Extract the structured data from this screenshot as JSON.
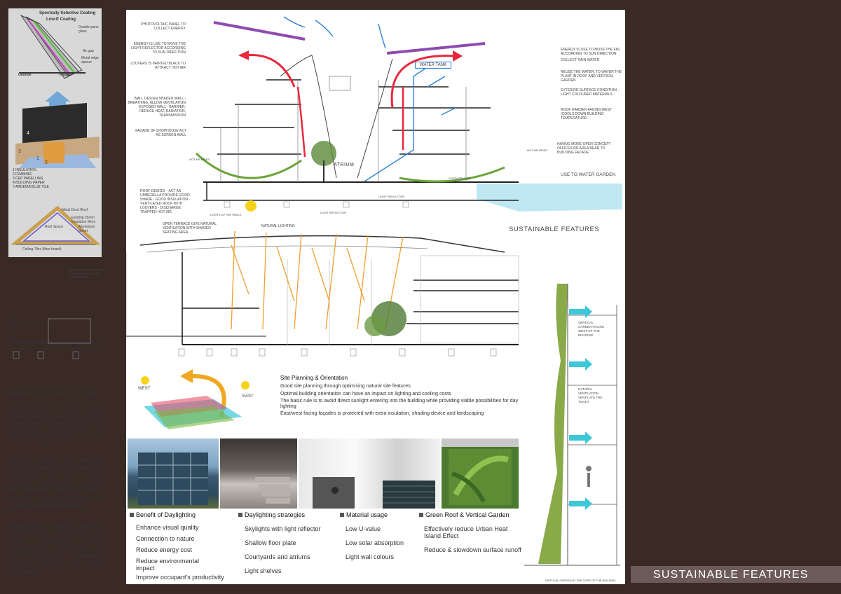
{
  "title_banner": "SUSTAINABLE FEATURES",
  "section_title": "SUSTAINABLE FEATURES",
  "coating_diagram": {
    "title1": "Spectrally Selective Coating",
    "title2": "Low-E Coating",
    "labels": [
      "Double-pane glass",
      "Air gap",
      "Metal edge spacer"
    ],
    "outside": "Outside",
    "inside": "Inside"
  },
  "roof_layers": {
    "numbers": [
      "1",
      "2",
      "3",
      "4"
    ],
    "list": [
      "1 INSULATION",
      "2 FRAMING",
      "3 CEP PANELLING",
      "4 BUILDING PAPER",
      "7 ARDESIA BLUE TILE"
    ]
  },
  "roof_section": {
    "labels": [
      "Metal Deck Roof",
      "Existing 25mm Insulation Wool",
      "Roof Space",
      "Aluminium Sheet",
      "Ceiling Tiles (fiber board)"
    ]
  },
  "section_top": {
    "left_notes": [
      "PHOTOVOLTAIC PANEL TO COLLECT ENERGY",
      "ENERGY IS USE TO MOVE THE LIGHT REFLECTOR ACCORDING TO SUN DIRECTION",
      "LOUVERS IS PAINTED BLACK TO ATTRACT HOT AIR",
      "WALL DESIGN SHADED WALL - BREATHING, ALLOW VENTILATION EXPOSED WALL - BARRIER, REDUCE HEAT, RADIATION, TRANSMISSION",
      "FACADE OF SHOPHOUSE ACT AS SCREEN WALL"
    ],
    "right_notes": [
      "ENERGY IS USE TO MOVE THE FIN ACCORDING TO SUN DIRECTION",
      "COLLECT RAIN WATER",
      "REUSE THE WATER, TO WATER THE PLANT IN ROOF AND VERTICAL GARDEN",
      "EXTERIOR SURFACE CONDITION -LIGHT COLOURED MATERIALS",
      "ROOF GARDEN FACING WEST (COOLS DOWN BUILDING TEMPERATURE",
      "HAVING MORE OPEN CONCEPT OFFICES OR AREA NEAR TO BUILDING FACADE",
      "USE TO WATER GARDEN"
    ],
    "water_tank": "WATER TANK",
    "atrium": "ATRIUM",
    "hot_air_rises_left": "HOT AIR RISES",
    "hot_air_rises_right": "HOT AIR RISES",
    "outdoor_cafe": "OUTDOOR CAFE",
    "roof_design": "ROOF DESIGN: - ACT AS UMBERELLA PROVIDE GOOD SHADE - GOOD INSULATION - VENTILATED ROOF WITH LOUVERS - DISCHARGE TRAPPED HOT AIR",
    "lights_up": "LIGHTS UP THE SPACE",
    "light_reflector": "LIGHT REFLECTOR",
    "light_reflector2": "LIGHT REFLECTOR"
  },
  "section_mid": {
    "open_terrace": "OPEN TERRACE GIVE NATURAL VENTILATION WITH SHADED SEATING AREA",
    "natural_lighting": "NATURAL LIGHTING",
    "water_element": "WATER ELEMENT HELPS REDUCING HEAT INSIDE THE BUILDING"
  },
  "vertical_garden": {
    "notes": [
      "VERTICAL GARDEN FACING WEST OF THE BUILDING",
      "NATURAL VENTILATION VENTILATE THE TOILET"
    ],
    "bottom": "VERTICAL GARDEN AT THE CORE OF THE BUILDING"
  },
  "sun_path": {
    "west": "WEST",
    "east": "EAST"
  },
  "site_planning": {
    "title": "Site Planning & Orientation",
    "lines": [
      "Good site planning through optimising natural site features",
      "Optimal building orientation can have an impact on lighting and cooling costs",
      "The basic rule is to avoid direct sunlight entering into the building while providing viable possibilities for day lighting",
      "East/west facing façades is protected with extra insulation, shading device and landscaping"
    ]
  },
  "green_architecture": {
    "title": "GREEN ARCHITECTURE",
    "paragraphs": [
      "The design of spaces and places that respects the natural environment resources in our environment and concerns for human being comfort",
      "Building methods and materials that conserve energy water and resources, use low impact materials, maximize longevity and durability, minimize waste, recycles other buildings and makes buildings healthier\"",
      "Addressing the various impacts of the built environment on future generations and demanding an examination of the relationship between ecology, economics and social well-being"
    ]
  },
  "categories": [
    {
      "title": "Benefit of Daylighting",
      "items": [
        "Enhance visual quality",
        "Connection to nature",
        "Reduce energy cost",
        "Reduce environmental impact",
        "Improve occupant's productivity"
      ]
    },
    {
      "title": "Daylighting strategies",
      "items": [
        "Skylights with light reflector",
        "Shallow floor plate",
        "Courtyards and atriums",
        "Light shelves"
      ]
    },
    {
      "title": "Material usage",
      "items": [
        "Low U-value",
        "Low solar absorption",
        "Light wall colours"
      ]
    },
    {
      "title": "Green Roof & Vertical Garden",
      "items": [
        "Effectively reduce Urban Heat Island Effect",
        "Reduce & slowdown surface runoff"
      ]
    }
  ],
  "colors": {
    "background": "#3a2a26",
    "sheet": "#ffffff",
    "red_arrow": "#e8283c",
    "blue_arrow": "#2a7fd6",
    "green_curve": "#6aa537",
    "purple_panel": "#8e4bb0",
    "orange_rays": "#f0a030",
    "cyan_arrow": "#3cc8d8"
  }
}
